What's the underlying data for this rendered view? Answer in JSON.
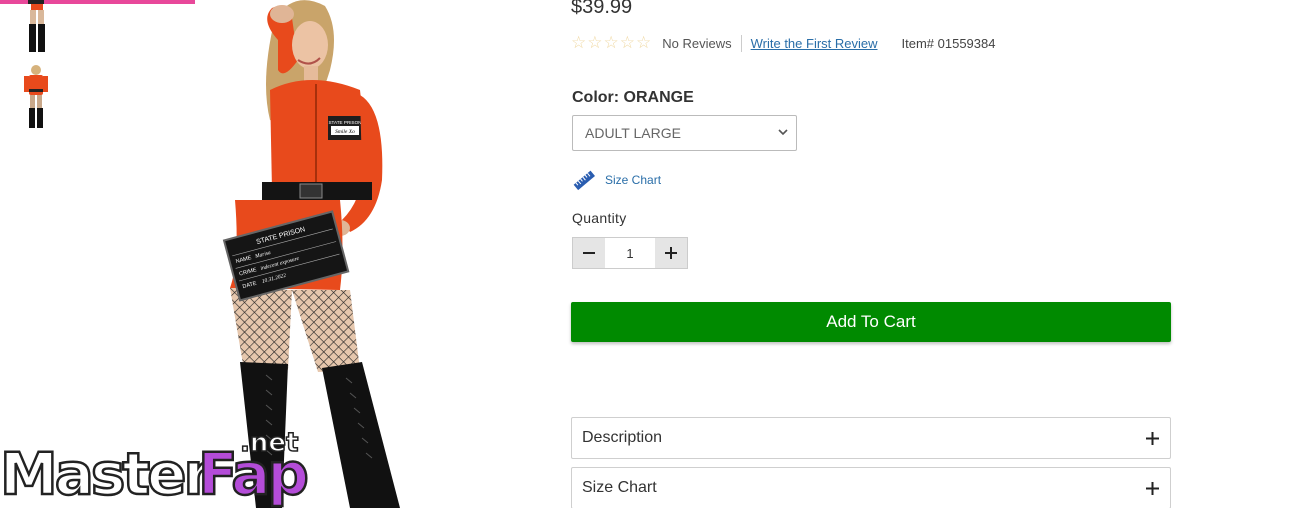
{
  "gallery": {
    "thumbnails": [
      "costume-thumbnail-front",
      "costume-thumbnail-full"
    ],
    "main_image": "woman-in-orange-prison-jumpsuit-costume",
    "active_indicator_color": "#e8489a"
  },
  "mugshot_sign": {
    "line1": "STATE PRISON",
    "name_label": "NAME",
    "name_value": "Marisa",
    "crime_label": "CRIME",
    "crime_value": "indecent exposure",
    "date_label": "DATE",
    "date_value": "10.31.2022"
  },
  "badge": {
    "line1": "STATE PRISON",
    "line2": "Smile Xo"
  },
  "watermark": {
    "part1": "Master",
    "part2": "Fap",
    "suffix": ".net"
  },
  "product": {
    "price": "$39.99",
    "rating": {
      "stars": 0,
      "max": 5,
      "reviews_text": "No Reviews",
      "write_review": "Write the First Review"
    },
    "item_number": "Item# 01559384",
    "color_label": "Color: ORANGE",
    "size_selected": "ADULT LARGE",
    "size_chart_link": "Size Chart",
    "quantity_label": "Quantity",
    "quantity": "1",
    "add_to_cart": "Add To Cart",
    "accordions": [
      {
        "label": "Description"
      },
      {
        "label": "Size Chart"
      }
    ]
  },
  "colors": {
    "add_to_cart": "#008a00",
    "link": "#2a6ea8",
    "star_empty": "#f0d9a4",
    "jumpsuit": "#e84a1c"
  },
  "icons": {
    "ruler": "ruler-icon",
    "minus": "minus-icon",
    "plus": "plus-icon",
    "chevron": "chevron-down-icon"
  }
}
